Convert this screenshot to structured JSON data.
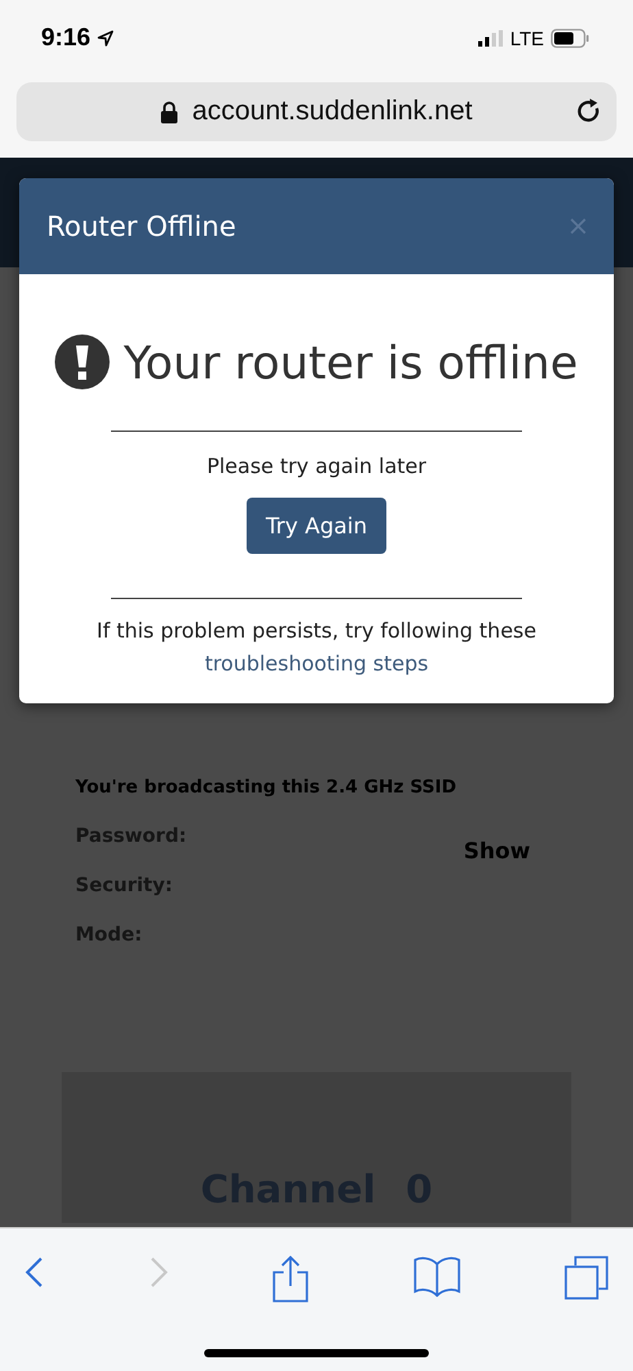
{
  "status_bar": {
    "time": "9:16",
    "network": "LTE"
  },
  "address_bar": {
    "url": "account.suddenlink.net"
  },
  "page": {
    "broadcast_note": "You're broadcasting this 2.4 GHz SSID",
    "fields": [
      {
        "label": "Password:",
        "action": "Show"
      },
      {
        "label": "Security:"
      },
      {
        "label": "Mode:"
      }
    ],
    "channel": {
      "label": "Channel",
      "value": "0"
    }
  },
  "dialog": {
    "title": "Router Offline",
    "heading": "Your router is offline",
    "message": "Please try again later",
    "button": "Try Again",
    "footer_text": "If this problem persists, try following these",
    "footer_link": "troubleshooting steps"
  },
  "toolbar": [
    {
      "kind": "back",
      "disabled": false
    },
    {
      "kind": "forward",
      "disabled": true
    },
    {
      "kind": "share",
      "disabled": false
    },
    {
      "kind": "bookmarks",
      "disabled": false
    },
    {
      "kind": "tabs",
      "disabled": false
    }
  ]
}
